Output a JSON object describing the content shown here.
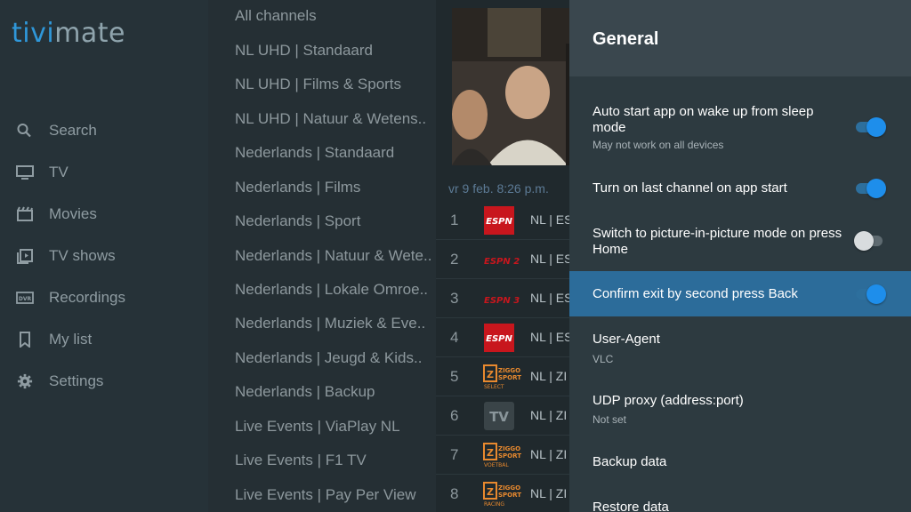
{
  "app": {
    "logo_part1": "tivi",
    "logo_part2": "mate"
  },
  "nav": {
    "items": [
      {
        "label": "Search",
        "icon": "search-icon"
      },
      {
        "label": "TV",
        "icon": "tv-icon"
      },
      {
        "label": "Movies",
        "icon": "movie-icon"
      },
      {
        "label": "TV shows",
        "icon": "tv-shows-icon"
      },
      {
        "label": "Recordings",
        "icon": "dvr-icon"
      },
      {
        "label": "My list",
        "icon": "bookmark-icon"
      },
      {
        "label": "Settings",
        "icon": "gear-icon"
      }
    ]
  },
  "groups": [
    "All channels",
    "NL UHD | Standaard",
    "NL UHD | Films & Sports",
    "NL UHD | Natuur & Wetens..",
    "Nederlands | Standaard",
    "Nederlands | Films",
    "Nederlands | Sport",
    "Nederlands | Natuur & Wete..",
    "Nederlands | Lokale Omroe..",
    "Nederlands | Muziek & Eve..",
    "Nederlands | Jeugd & Kids..",
    "Nederlands | Backup",
    "Live Events | ViaPlay NL",
    "Live Events | F1 TV",
    "Live Events | Pay Per View"
  ],
  "channels": {
    "date": "vr 9 feb. 8:26 p.m.",
    "rows": [
      {
        "num": "1",
        "logo": "espn-logo",
        "name": "NL | ES"
      },
      {
        "num": "2",
        "logo": "espn2-logo",
        "name": "NL | ES"
      },
      {
        "num": "3",
        "logo": "espn3-logo",
        "name": "NL | ES"
      },
      {
        "num": "4",
        "logo": "espn-logo",
        "name": "NL | ES"
      },
      {
        "num": "5",
        "logo": "ziggo-sport-select-logo",
        "name": "NL | ZI"
      },
      {
        "num": "6",
        "logo": "tv-placeholder-logo",
        "name": "NL | ZI"
      },
      {
        "num": "7",
        "logo": "ziggo-sport-voetbal-logo",
        "name": "NL | ZI"
      },
      {
        "num": "8",
        "logo": "ziggo-sport-racing-logo",
        "name": "NL | ZI"
      }
    ],
    "logo_text": {
      "espn": "ESPN",
      "espn2": "ESPN 2",
      "espn3": "ESPN 3",
      "tv": "TV",
      "ziggo": "ZIGGO",
      "sport": "SPORT",
      "select": "SELECT",
      "voetbal": "VOETBAL",
      "racing": "RACING"
    }
  },
  "settings": {
    "title": "General",
    "items": [
      {
        "title": "Auto start app on wake up from sleep mode",
        "subtitle": "May not work on all devices",
        "toggle": true
      },
      {
        "title": "Turn on last channel on app start",
        "toggle": true
      },
      {
        "title": "Switch to picture-in-picture mode on press Home",
        "toggle": false
      },
      {
        "title": "Confirm exit by second press Back",
        "toggle": true,
        "selected": true
      },
      {
        "title": "User-Agent",
        "subtitle": "VLC"
      },
      {
        "title": "UDP proxy (address:port)",
        "subtitle": "Not set"
      },
      {
        "title": "Backup data"
      },
      {
        "title": "Restore data"
      }
    ]
  },
  "colors": {
    "accent": "#1e8eeb",
    "selected_row": "#2c6c9a",
    "logo_blue": "#2f97d9",
    "espn_red": "#c8161d",
    "ziggo_orange": "#e8892e"
  }
}
